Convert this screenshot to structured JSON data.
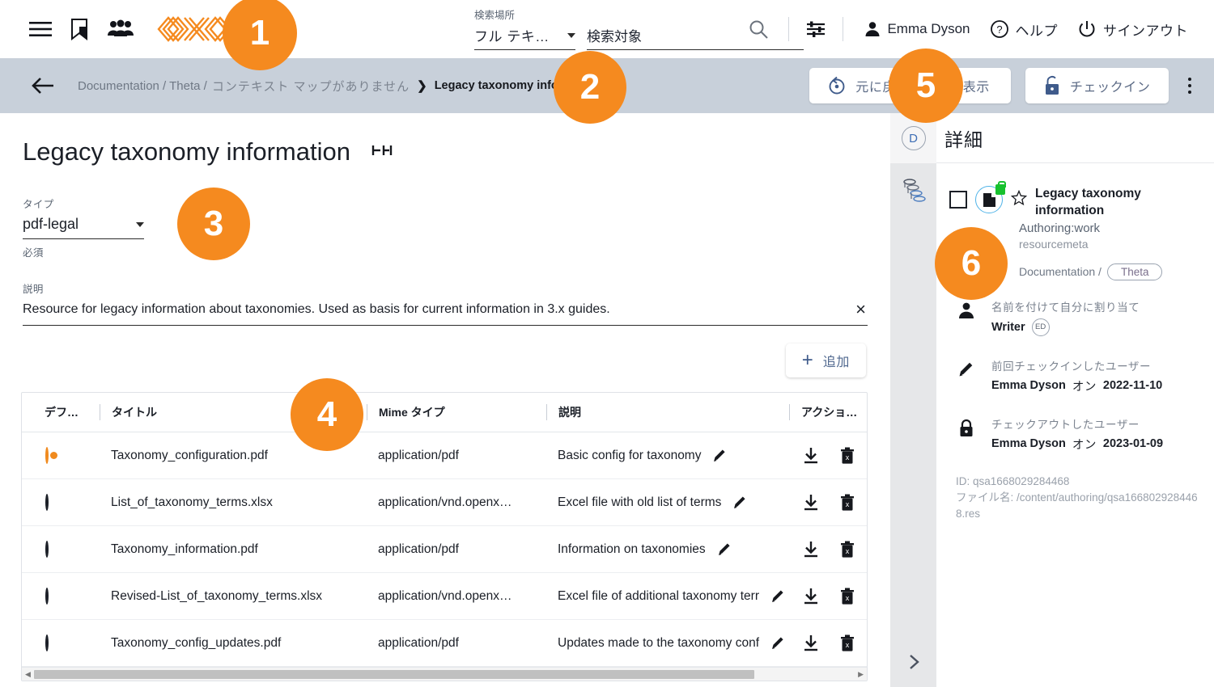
{
  "topbar": {
    "icons": [
      "hamburger-menu-icon",
      "bookmark-icon",
      "people-icon",
      "brand-logo-icon"
    ],
    "search": {
      "scope_label": "検索場所",
      "scope_value": "フル テキ…",
      "input_placeholder": "検索対象",
      "input_value": ""
    },
    "search_icon": "search-icon",
    "filter_icon": "filter-settings-icon",
    "user_name": "Emma Dyson",
    "help_label": "ヘルプ",
    "signout_label": "サインアウト"
  },
  "breadcrumb": {
    "back": "back-arrow-icon",
    "part1": "Documentation / Theta /",
    "part2": "コンテキスト マップがありません",
    "separator": "❯",
    "current": "Legacy taxonomy information",
    "actions": {
      "undo_label": "元に戻す",
      "view_label": "表示",
      "checkin_label": "チェックイン",
      "kebab": "more-options-icon"
    }
  },
  "main": {
    "page_title": "Legacy taxonomy information",
    "title_icon": "resize-width-icon",
    "type_field": {
      "label": "タイプ",
      "value": "pdf-legal",
      "hint": "必須"
    },
    "desc_field": {
      "label": "説明",
      "value": "Resource for legacy information about taxonomies. Used as basis for current information in 3.x guides.",
      "clear": "×"
    },
    "add_button": {
      "plus": "+",
      "label": "追加"
    },
    "table": {
      "columns": [
        "デフ…",
        "タイトル",
        "Mime タイプ",
        "説明",
        "アクショ…"
      ],
      "rows": [
        {
          "default": true,
          "title": "Taxonomy_configuration.pdf",
          "mime": "application/pdf",
          "description": "Basic config for taxonomy"
        },
        {
          "default": false,
          "title": "List_of_taxonomy_terms.xlsx",
          "mime": "application/vnd.openx…",
          "description": "Excel file with old list of terms"
        },
        {
          "default": false,
          "title": "Taxonomy_information.pdf",
          "mime": "application/pdf",
          "description": "Information on taxonomies"
        },
        {
          "default": false,
          "title": "Revised-List_of_taxonomy_terms.xlsx",
          "mime": "application/vnd.openx…",
          "description": "Excel file of additional taxonomy terr"
        },
        {
          "default": false,
          "title": "Taxonomy_config_updates.pdf",
          "mime": "application/pdf",
          "description": "Updates made to the taxonomy conf"
        }
      ]
    }
  },
  "right_panel": {
    "strip": {
      "details_tab": "D",
      "hierarchy_icon": "hierarchy-tree-icon",
      "expand_icon": "chevron-right-icon"
    },
    "header": "詳細",
    "resource": {
      "title": "Legacy taxonomy information",
      "type_line": "Authoring:work",
      "subtype_line": "resourcemeta",
      "path_prefix": "Documentation /",
      "path_chip": "Theta"
    },
    "meta": [
      {
        "icon": "person-icon",
        "label": "名前を付けて自分に割り当て",
        "value": "Writer",
        "badge": "ED"
      },
      {
        "icon": "pencil-icon",
        "label": "前回チェックインしたユーザー",
        "value_name": "Emma Dyson",
        "value_on": "オン",
        "value_date": "2022-11-10"
      },
      {
        "icon": "lock-icon",
        "label": "チェックアウトしたユーザー",
        "value_name": "Emma Dyson",
        "value_on": "オン",
        "value_date": "2023-01-09"
      }
    ],
    "id_line": "ID: qsa1668029284468",
    "file_line": "ファイル名: /content/authoring/qsa1668029284468.res"
  },
  "callouts": [
    "1",
    "2",
    "3",
    "4",
    "5",
    "6"
  ],
  "colors": {
    "accent_orange": "#f58a1f",
    "breadcrumb_bg": "#c8d0da",
    "strip_bg": "#e6e7e9",
    "link_blue": "#50688f",
    "lock_green": "#17c12e"
  }
}
